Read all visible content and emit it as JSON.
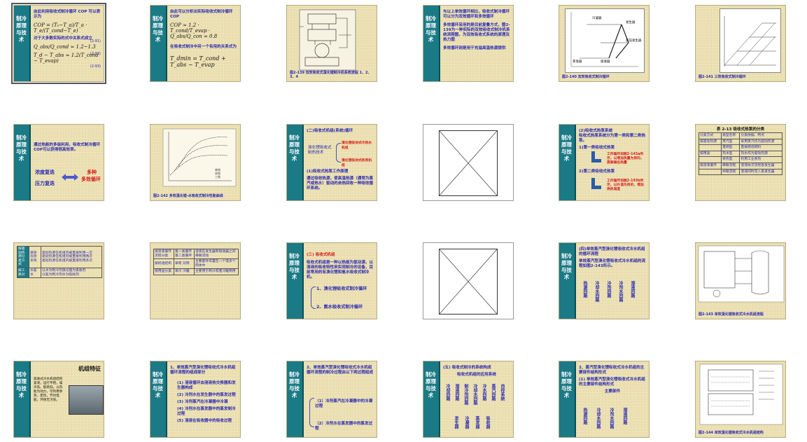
{
  "sidebar_label": "制冷原理与技术",
  "slides": [
    {
      "id": 1,
      "selected": true,
      "lines": [
        "由此利用吸收式制冷循环 COP 可以表示为",
        "对于大多数实际的式中关系式成立"
      ],
      "formulas": [
        "COP = (T₀−T_a)/T_a · T_e/(T_cond−T_e)",
        "Q_abs/Q_cond ≈ 1.2~1.3",
        "T_d − T_abs ≈ 1.2(T_cond − T_evap)"
      ],
      "eq_nums": [
        "(2-91)",
        "(2-92)",
        "(2-93)"
      ]
    },
    {
      "id": 2,
      "lines": [
        "由此可以分析出实际吸收式制冷循环COP",
        "在吸收式制冷中另一个有用的关系式为"
      ],
      "formulas": [
        "COP ≈ 1.2 · T_cond/T_evap · Q_abs/Q_con ≈ 0.8",
        "T_dmin = T_cond + T_abs − T_evap"
      ],
      "eq_nums": [
        "(2-94)",
        "(2-95)"
      ]
    },
    {
      "id": 3,
      "caption": "图2-139  双效吸收式溴化锂制冷机系统流程 1、2、3、4"
    },
    {
      "id": 4,
      "lines": [
        "与以上单效循环相比，吸收式制冷循环可以分为双效循环和多效循环",
        "多效循环采用的是目前复叠方式，图2-139为一种实际的双效吸收式制冷机系统流程图，为双效吸收式系统的原理及热力图",
        "多效循环则是用于充溢高温热源提供"
      ]
    },
    {
      "id": 5,
      "labels": [
        "冷凝器",
        "发生器",
        "高压发生器",
        "蒸发器",
        "吸收器"
      ],
      "caption": "图2-140  双效吸收式制冷循环"
    },
    {
      "id": 6,
      "caption": "图2-141  三效吸收式制冷循环"
    },
    {
      "id": 7,
      "lines": [
        "通过热能的多级利用，吸收式制冷循环COP可以获得很高效率。"
      ],
      "left_items": [
        "浓度复迭",
        "压力复迭"
      ],
      "right_items": [
        "多种",
        "多效循环"
      ]
    },
    {
      "id": 8,
      "legend": [
        "单效",
        "双效",
        "三效"
      ],
      "caption": "图2-142  多效溴化锂-水吸收式制冷性能曲线"
    },
    {
      "id": 9,
      "heading": "(二)吸收式机组(系统)循环",
      "left_box": [
        "溴化锂吸收式",
        "制热技术"
      ],
      "branches": [
        "溴化锂吸收式冷热水机组",
        "溴化锂吸收式热泵机组"
      ],
      "sub_heading": "(1)吸收式热泵工作原理",
      "lines": [
        "通过吸收热源，使高温热源（通常为蒸汽或热水）驱动的余热回收一种吸收循环系统。"
      ]
    },
    {
      "id": 10,
      "blank": true
    },
    {
      "id": 11,
      "heading": "(2)吸收式热泵系统",
      "lines": [
        "吸收式热泵系统分为第一类和第二类热泵。"
      ],
      "items": [
        "1)第一类吸收式热泵",
        "2)第二类吸收式热泵"
      ],
      "notes": [
        "工作循环如图2-143a所示，以增加热量为目的，提高输出热量",
        "工作循环如图2-143b所示，以升温为目的，增加供热温度"
      ]
    },
    {
      "id": 12,
      "heading": "表 2-13  吸收式热泵的分类",
      "headers": [
        "分类方式",
        "类型名称",
        "分类依据、特点"
      ],
      "rows": [
        [
          "按驱动热源",
          "蒸汽型",
          "采用蒸汽作为驱动热源"
        ],
        [
          "",
          "直燃型",
          "直接燃烧燃料"
        ],
        [
          "按用途",
          "热水型",
          "热水作为驱动热源"
        ],
        [
          "",
          "余热型",
          "利用工业余热"
        ],
        [
          "按溶液循环",
          "串联流程",
          "溶液依次流经各发生器"
        ],
        [
          "",
          "并联流程",
          "溶液同时流入各发生器"
        ]
      ]
    },
    {
      "id": 13,
      "left_col": [
        "按驱动热源分类方式",
        "按工质对"
      ],
      "mid_col": [
        "单效双效多效",
        "水氨水"
      ],
      "rows": [
        "驱动热源在机组内被直接利用一次",
        "驱动热源在机组内被直接利用两次",
        "驱动热源在机组内被直接利用多次",
        "以水为制冷剂溴化锂为吸收剂",
        "以氨为制冷剂水为吸收剂"
      ]
    },
    {
      "id": 14,
      "rows": [
        [
          "按溶液循环流程分类",
          "第一类循环 第二类循环",
          "溶液在发生器和吸收器之间串联流动"
        ],
        [
          "按机组结构",
          "单筒 双筒",
          "主要部件布置在一个或多个筒体中"
        ],
        [
          "按用途分类",
          "单冷 冷暖",
          "主要用于制冷或者冷暖两用"
        ]
      ]
    },
    {
      "id": 15,
      "heading": "(三)  吸收式机组",
      "lines": [
        "吸收式机组是一种以热能为驱动源，以溶液的吸收特性来实现制冷的设备，目前常用的有溴化锂和氨水吸收式制冷机。"
      ],
      "items": [
        "1、溴化锂吸收式制冷循环",
        "2、氨水吸收式制冷循环"
      ]
    },
    {
      "id": 16,
      "blank": true
    },
    {
      "id": 17,
      "heading": "(四)单效蒸汽型溴化锂吸收式冷水机组的循环流程",
      "lines": [
        "单效蒸汽型溴化锂吸收式冷水机组的流程如图2-143所示。"
      ],
      "columns": [
        "热源回路",
        "冷却水回路",
        "冷剂回路",
        "冷剂水回路",
        "溶液回路"
      ]
    },
    {
      "id": 18,
      "caption": "图2-143  单效溴化锂吸收式冷水机组流程"
    },
    {
      "id": 19,
      "heading": "机组特征",
      "lines": [
        "吸收式冷水机组结构紧凑，运行平稳，噪声低，能耗低，以热能为动力，可利用余热、废热，节约电能，环保无污染。"
      ]
    },
    {
      "id": 20,
      "heading": "1、单效蒸汽型溴化锂吸收式冷水机组循环流程的组成部分",
      "items": [
        "(1) 溶液循环由溶液热交换器和发生器构成",
        "(2) 冷剂水在发生器中的蒸发过程",
        "(3) 冷剂蒸汽在冷凝器中冷凝",
        "(4) 冷剂水在蒸发器中的蒸发制冷过程",
        "(5) 溶液在吸收器中的吸收过程"
      ]
    },
    {
      "id": 21,
      "heading": "2、单效蒸汽型溴化锂吸收式冷水机组循环流程的制冷过程由以下两过程组成",
      "items": [
        "（1）冷剂蒸汽在冷凝器中的冷凝过程",
        "（2）冷剂水在蒸发器中的蒸发过程"
      ]
    },
    {
      "id": 22,
      "heading": "(五)  吸收式制冷的系统构成",
      "sub_heading": "吸收式机组的应用系统",
      "columns": [
        "冷却回路",
        "溶液回路",
        "制冷剂回路",
        "冷却水回路",
        "冷水回路",
        "蒸汽回路",
        "自控系统"
      ],
      "bottom": [
        "发生器",
        "冷凝器",
        "蒸发器",
        "吸收器"
      ]
    },
    {
      "id": 23,
      "heading": "2、蒸汽型溴化锂吸收式冷水机组的主要部件结构形式",
      "lines": [
        "(1) 单效蒸汽型溴化锂吸收式冷水机组的主要部件结构形式"
      ],
      "sub_heading": "主要部件",
      "columns": [
        "热源回路",
        "冷却水回路",
        "冷剂水回路",
        "溶液回路"
      ]
    },
    {
      "id": 24,
      "caption": "图2-144  单效溴化锂吸收式冷水机组结构"
    }
  ]
}
